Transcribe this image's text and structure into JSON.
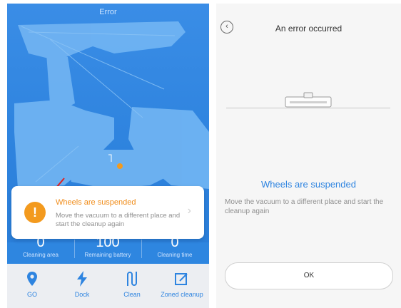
{
  "left": {
    "header_title": "Error",
    "error_card": {
      "title": "Wheels are suspended",
      "description": "Move the vacuum to a different place and start the cleanup again"
    },
    "stats": [
      {
        "value": "0",
        "label": "Cleaning area"
      },
      {
        "value": "100",
        "label": "Remaining battery"
      },
      {
        "value": "0",
        "label": "Cleaning time"
      }
    ],
    "toolbar": [
      {
        "label": "GO",
        "icon": "location-pin-icon"
      },
      {
        "label": "Dock",
        "icon": "lightning-icon"
      },
      {
        "label": "Clean",
        "icon": "clean-path-icon"
      },
      {
        "label": "Zoned cleanup",
        "icon": "edit-square-icon"
      }
    ]
  },
  "right": {
    "title": "An error occurred",
    "error_title": "Wheels are suspended",
    "error_description": "Move the vacuum to a different place and start the cleanup again",
    "ok_label": "OK"
  },
  "colors": {
    "accent": "#2e84e0",
    "warning": "#f39a1e"
  }
}
